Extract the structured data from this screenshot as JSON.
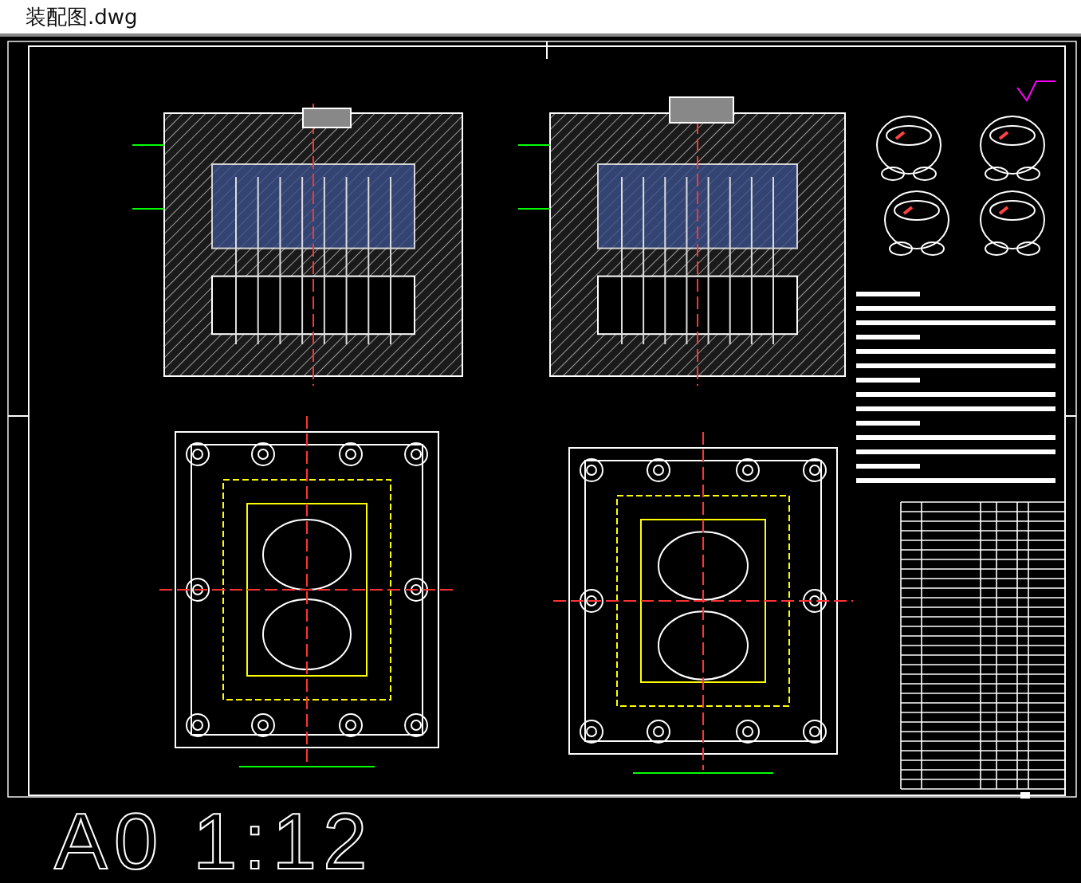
{
  "window": {
    "title": "装配图.dwg"
  },
  "canvas": {
    "scale_label": "A0 1:12"
  }
}
